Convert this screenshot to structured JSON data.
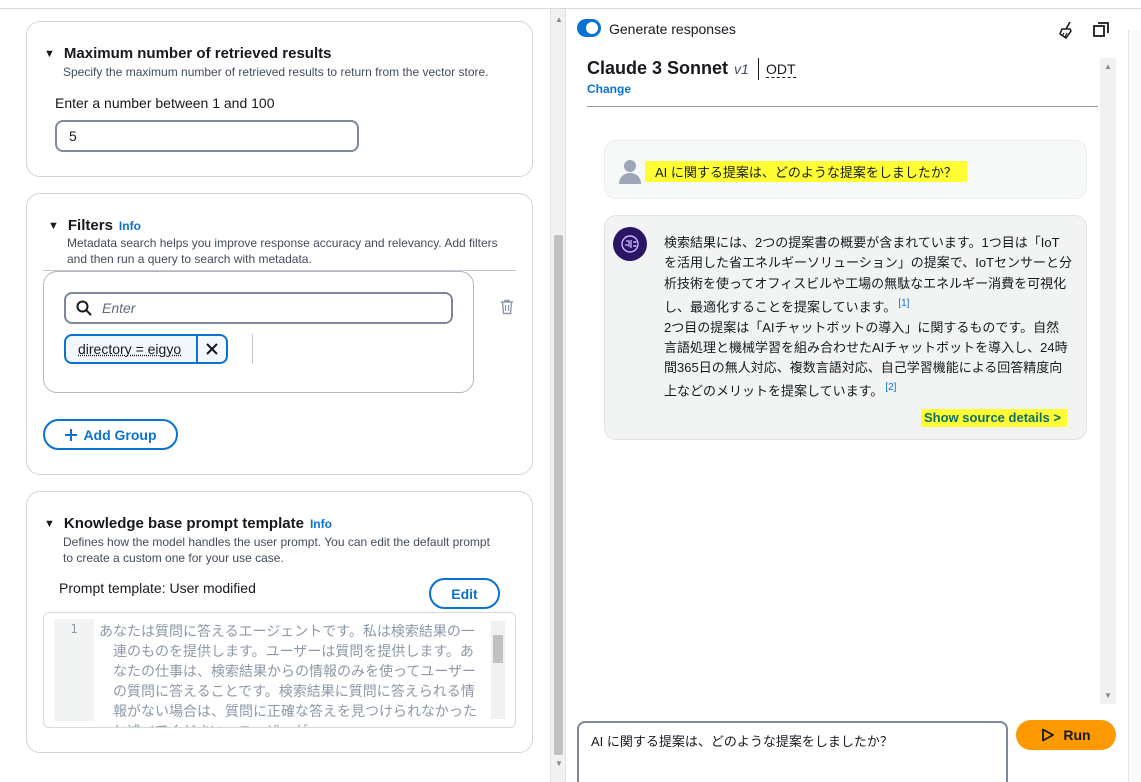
{
  "config": {
    "max_results": {
      "title": "Maximum number of retrieved results",
      "description": "Specify the maximum number of retrieved results to return from the vector store.",
      "input_label": "Enter a number between 1 and 100",
      "value": "5"
    },
    "filters": {
      "title": "Filters",
      "info": "Info",
      "description_line1": "Metadata search helps you improve response accuracy and relevancy. Add filters",
      "description_line2": "and then run a query to search with metadata.",
      "search_placeholder": "Enter",
      "token": "directory = eigyo",
      "add_group": "Add Group"
    },
    "prompt_template": {
      "title": "Knowledge base prompt template",
      "info": "Info",
      "description_line1": "Defines how the model handles the user prompt. You can edit the default prompt",
      "description_line2": "to create a custom one for your use case.",
      "status": "Prompt template: User modified",
      "edit": "Edit",
      "line_number": "1",
      "code": "あなたは質問に答えるエージェントです。私は検索結果の一連のものを提供します。ユーザーは質問を提供します。あなたの仕事は、検索結果からの情報のみを使ってユーザーの質問に答えることです。検索結果に質問に答えられる情報がない場合は、質問に正確な答えを見つけられなかったと述べてください。ユーザーが"
    }
  },
  "chat": {
    "generate_label": "Generate responses",
    "generate_on": true,
    "model_name": "Claude 3 Sonnet",
    "model_version": "v1",
    "model_region": "ODT",
    "change": "Change",
    "user_message": "AI に関する提案は、どのような提案をしましたか？",
    "bot_part1": "検索結果には、2つの提案書の概要が含まれています。1つ目は「IoTを活用した省エネルギーソリューション」の提案で、IoTセンサーと分析技術を使ってオフィスビルや工場の無駄なエネルギー消費を可視化し、最適化することを提案しています。",
    "cite1": "[1]",
    "bot_part2": "2つ目の提案は「AIチャットボットの導入」に関するものです。自然言語処理と機械学習を組み合わせたAIチャットボットを導入し、24時間365日の無人対応、複数言語対応、自己学習機能による回答精度向上などのメリットを提案しています。",
    "cite2": "[2]",
    "show_source": "Show source details >",
    "prompt_value": "AI に関する提案は、どのような提案をしましたか？",
    "run": "Run"
  },
  "colors": {
    "accent": "#0972d3",
    "run": "#ff9900",
    "highlight": "#ffff33"
  }
}
